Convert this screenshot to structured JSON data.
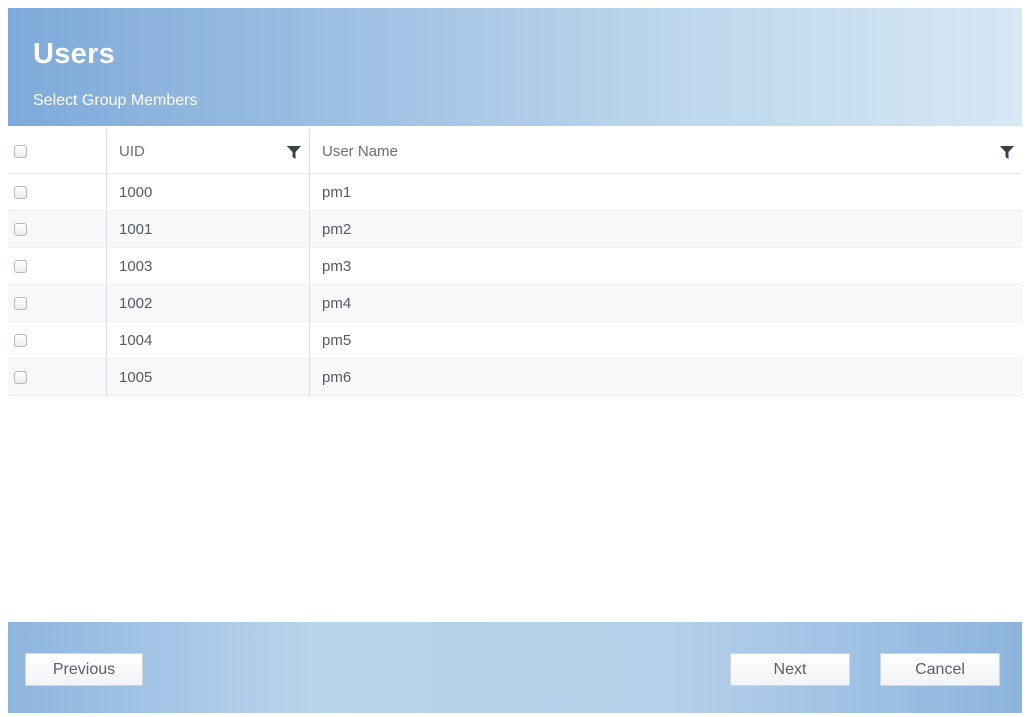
{
  "header": {
    "title": "Users",
    "subtitle": "Select Group Members"
  },
  "table": {
    "columns": {
      "uid": "UID",
      "user_name": "User Name"
    },
    "rows": [
      {
        "uid": "1000",
        "user_name": "pm1",
        "checked": false
      },
      {
        "uid": "1001",
        "user_name": "pm2",
        "checked": false
      },
      {
        "uid": "1003",
        "user_name": "pm3",
        "checked": false
      },
      {
        "uid": "1002",
        "user_name": "pm4",
        "checked": false
      },
      {
        "uid": "1004",
        "user_name": "pm5",
        "checked": false
      },
      {
        "uid": "1005",
        "user_name": "pm6",
        "checked": false
      }
    ]
  },
  "footer": {
    "previous_label": "Previous",
    "next_label": "Next",
    "cancel_label": "Cancel"
  },
  "icons": {
    "column_filter": "filter-icon",
    "row_select": "checkbox-icon"
  },
  "colors": {
    "header_gradient_start": "#7eaad9",
    "header_gradient_end": "#d6e8f4",
    "footer_gradient": "#b9d4ec"
  }
}
